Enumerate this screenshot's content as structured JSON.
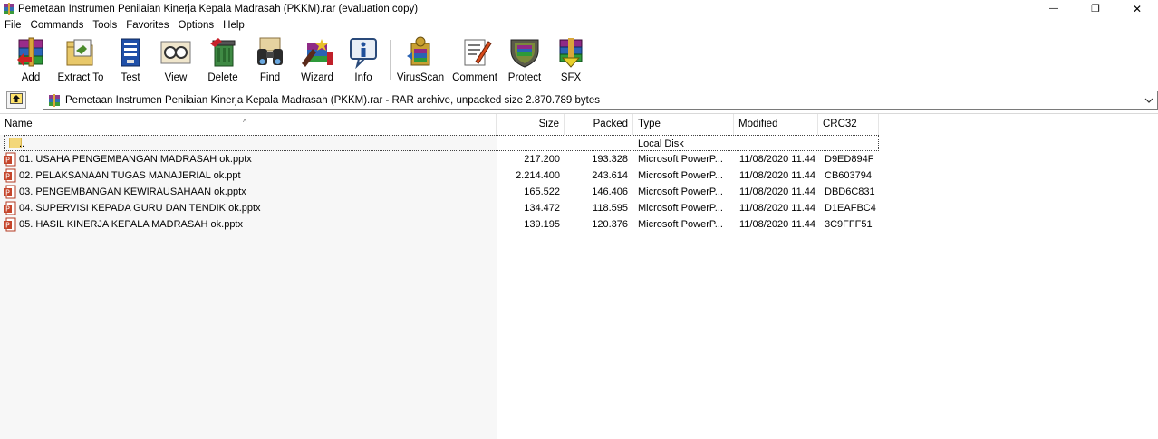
{
  "window": {
    "title": "Pemetaan Instrumen Penilaian Kinerja Kepala Madrasah (PKKM).rar (evaluation copy)",
    "minimize_glyph": "—",
    "maximize_glyph": "❐",
    "close_glyph": "✕"
  },
  "menu": [
    "File",
    "Commands",
    "Tools",
    "Favorites",
    "Options",
    "Help"
  ],
  "toolbar": [
    {
      "label": "Add",
      "icon": "add-archive-icon"
    },
    {
      "label": "Extract To",
      "icon": "extract-icon"
    },
    {
      "label": "Test",
      "icon": "test-icon"
    },
    {
      "label": "View",
      "icon": "view-icon"
    },
    {
      "label": "Delete",
      "icon": "delete-icon"
    },
    {
      "label": "Find",
      "icon": "find-binoculars-icon"
    },
    {
      "label": "Wizard",
      "icon": "wizard-icon"
    },
    {
      "label": "Info",
      "icon": "info-icon"
    },
    {
      "label": "VirusScan",
      "icon": "virusscan-icon"
    },
    {
      "label": "Comment",
      "icon": "comment-icon"
    },
    {
      "label": "Protect",
      "icon": "protect-shield-icon"
    },
    {
      "label": "SFX",
      "icon": "sfx-icon"
    }
  ],
  "address": {
    "path": "Pemetaan Instrumen Penilaian Kinerja Kepala Madrasah (PKKM).rar - RAR archive, unpacked size 2.870.789 bytes"
  },
  "columns": {
    "name": "Name",
    "size": "Size",
    "packed": "Packed",
    "type": "Type",
    "modified": "Modified",
    "crc": "CRC32"
  },
  "updir": {
    "name": "..",
    "type": "Local Disk"
  },
  "files": [
    {
      "name": "01. USAHA PENGEMBANGAN MADRASAH ok.pptx",
      "size": "217.200",
      "packed": "193.328",
      "type": "Microsoft PowerP...",
      "modified": "11/08/2020 11.44",
      "crc": "D9ED894F"
    },
    {
      "name": "02. PELAKSANAAN TUGAS MANAJERIAL ok.ppt",
      "size": "2.214.400",
      "packed": "243.614",
      "type": "Microsoft PowerP...",
      "modified": "11/08/2020 11.44",
      "crc": "CB603794"
    },
    {
      "name": "03. PENGEMBANGAN KEWIRAUSAHAAN ok.pptx",
      "size": "165.522",
      "packed": "146.406",
      "type": "Microsoft PowerP...",
      "modified": "11/08/2020 11.44",
      "crc": "DBD6C831"
    },
    {
      "name": "04. SUPERVISI KEPADA GURU DAN TENDIK ok.pptx",
      "size": "134.472",
      "packed": "118.595",
      "type": "Microsoft PowerP...",
      "modified": "11/08/2020 11.44",
      "crc": "D1EAFBC4"
    },
    {
      "name": "05. HASIL KINERJA KEPALA MADRASAH ok.pptx",
      "size": "139.195",
      "packed": "120.376",
      "type": "Microsoft PowerP...",
      "modified": "11/08/2020 11.44",
      "crc": "3C9FFF51"
    }
  ],
  "colors": {
    "ppt_red": "#c4452b",
    "folder_yellow": "#f3d77a",
    "name_column_shade": "#f7f7f7"
  }
}
